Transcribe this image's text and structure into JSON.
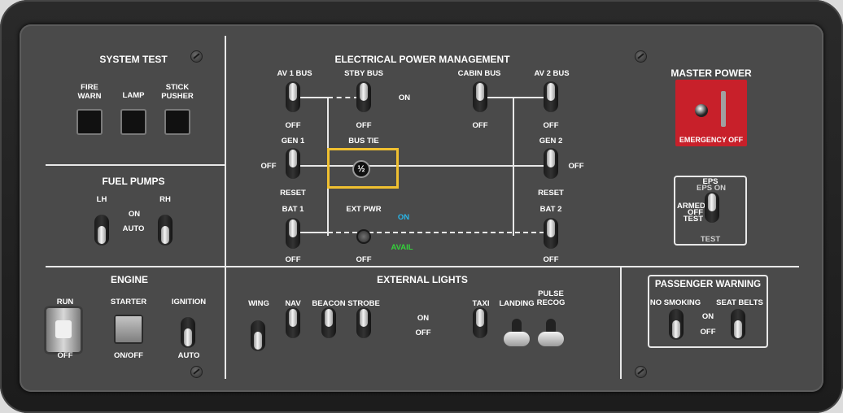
{
  "system_test": {
    "title": "SYSTEM TEST",
    "fire_warn": "FIRE\nWARN",
    "lamp": "LAMP",
    "stick_pusher": "STICK\nPUSHER"
  },
  "fuel_pumps": {
    "title": "FUEL PUMPS",
    "lh": "LH",
    "rh": "RH",
    "on": "ON",
    "auto": "AUTO"
  },
  "engine": {
    "title": "ENGINE",
    "run": "RUN",
    "off": "OFF",
    "starter": "STARTER",
    "starter_state": "ON/OFF",
    "ignition": "IGNITION",
    "ignition_state": "AUTO"
  },
  "epm": {
    "title": "ELECTRICAL POWER MANAGEMENT",
    "av1_bus": "AV 1 BUS",
    "stby_bus": "STBY BUS",
    "cabin_bus": "CABIN BUS",
    "av2_bus": "AV 2 BUS",
    "on": "ON",
    "off": "OFF",
    "gen1": "GEN 1",
    "gen2": "GEN 2",
    "bus_tie": "BUS TIE",
    "bus_tie_knob": "½",
    "reset": "RESET",
    "bat1": "BAT 1",
    "bat2": "BAT 2",
    "ext_pwr": "EXT PWR",
    "ext_on": "ON",
    "ext_avail": "AVAIL"
  },
  "master_power": {
    "title": "MASTER POWER",
    "emergency_off": "EMERGENCY OFF"
  },
  "eps": {
    "title": "EPS",
    "eps_on": "EPS ON",
    "armed": "ARMED",
    "off": "OFF",
    "test": "TEST",
    "test_bottom": "TEST"
  },
  "external_lights": {
    "title": "EXTERNAL LIGHTS",
    "wing": "WING",
    "nav": "NAV",
    "beacon": "BEACON",
    "strobe": "STROBE",
    "on": "ON",
    "off": "OFF",
    "taxi": "TAXI",
    "landing": "LANDING",
    "pulse_recog": "PULSE\nRECOG"
  },
  "passenger_warning": {
    "title": "PASSENGER WARNING",
    "no_smoking": "NO SMOKING",
    "seat_belts": "SEAT BELTS",
    "on": "ON",
    "off": "OFF"
  },
  "colors": {
    "highlight": "#f0c030",
    "master_red": "#c8202a",
    "ext_on": "#29b6e8",
    "avail": "#34d23a"
  }
}
